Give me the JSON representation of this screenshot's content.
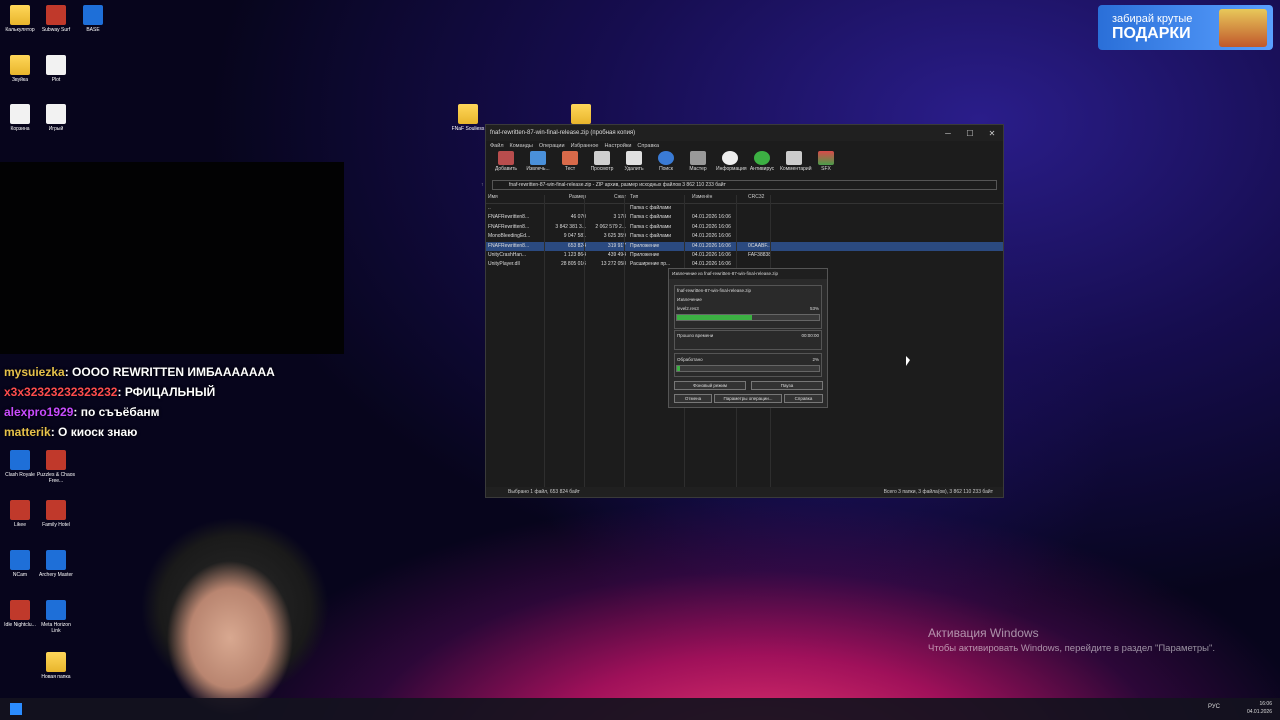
{
  "desktop_icons": [
    {
      "label": "Калькулятор",
      "icon": "folder-icon"
    },
    {
      "label": "Subway Surf",
      "icon": "subway-surf-icon"
    },
    {
      "label": "BASE",
      "icon": "base-app-icon"
    },
    {
      "label": "Звуйка",
      "icon": "folder-icon"
    },
    {
      "label": "Plot",
      "icon": "document-icon"
    },
    {
      "label": "Корзина",
      "icon": "recycle-bin-icon"
    },
    {
      "label": "Игрый",
      "icon": "document-icon"
    },
    {
      "label": "FNaF Souliess",
      "icon": "folder-icon"
    },
    {
      "label": "Clash Royale",
      "icon": "clash-royale-icon"
    },
    {
      "label": "Puzzles & Chaos Free...",
      "icon": "puzzles-icon"
    },
    {
      "label": "Likee",
      "icon": "likee-icon"
    },
    {
      "label": "Family Hotel",
      "icon": "family-hotel-icon"
    },
    {
      "label": "NCam",
      "icon": "ncam-icon"
    },
    {
      "label": "Archery Master",
      "icon": "archery-icon"
    },
    {
      "label": "Idle Nightclu...",
      "icon": "idle-icon"
    },
    {
      "label": "Meta Horizon Link",
      "icon": "meta-icon"
    },
    {
      "label": "Новая папка",
      "icon": "folder-icon"
    }
  ],
  "chat": [
    {
      "user": "mysuiezka",
      "msg": "OOOO REWRITTEN ИМБААААААА"
    },
    {
      "user": "x3x32323232323232",
      "msg": "РФИЦАЛЬНЫЙ"
    },
    {
      "user": "alexpro1929",
      "msg": "по съъёбанм"
    },
    {
      "user": "matterik",
      "msg": "О киоск знаю"
    }
  ],
  "promo": {
    "line1": "забирай крутые",
    "line2": "ПОДАРКИ"
  },
  "winrar": {
    "title": "fnaf-rewritten-87-win-final-release.zip (пробная копия)",
    "menu": [
      "Файл",
      "Команды",
      "Операции",
      "Избранное",
      "Настройки",
      "Справка"
    ],
    "toolbar": [
      "Добавить",
      "Извлечь...",
      "Тест",
      "Просмотр",
      "Удалить",
      "Поиск",
      "Мастер",
      "Информация",
      "Антивирус",
      "Комментарий",
      "SFX"
    ],
    "address": "fnaf-rewritten-87-win-final-release.zip - ZIP архив, размер исходных файлов 3 862 110 233 байт",
    "columns": [
      "Имя",
      "Размер",
      "Сжат",
      "Тип",
      "Изменён",
      "CRC32"
    ],
    "rows": [
      {
        "name": "..",
        "size": "",
        "packed": "",
        "type": "Папка с файлами",
        "modified": "",
        "crc": ""
      },
      {
        "name": "FNAFRewritten8...",
        "size": "46 070",
        "packed": "3 178",
        "type": "Папка с файлами",
        "modified": "04.01.2026 16:06",
        "crc": ""
      },
      {
        "name": "FNAFRewritten8...",
        "size": "3 842 381 3...",
        "packed": "2 062 579 2...",
        "type": "Папка с файлами",
        "modified": "04.01.2026 16:06",
        "crc": ""
      },
      {
        "name": "MonoBleedingEd...",
        "size": "9 047 581",
        "packed": "3 625 359",
        "type": "Папка с файлами",
        "modified": "04.01.2026 16:06",
        "crc": ""
      },
      {
        "name": "FNAFRewritten8...",
        "size": "653 824",
        "packed": "319 917",
        "type": "Приложение",
        "modified": "04.01.2026 16:06",
        "crc": "0CAABF..."
      },
      {
        "name": "UnityCrashHan...",
        "size": "1 123 864",
        "packed": "439 494",
        "type": "Приложение",
        "modified": "04.01.2026 16:06",
        "crc": "FAF38838"
      },
      {
        "name": "UnityPlayer.dll",
        "size": "28 805 016",
        "packed": "13 272 058",
        "type": "Расширение пр...",
        "modified": "04.01.2026 16:06",
        "crc": ""
      }
    ],
    "status_left": "Выбрано 1 файл, 653 824 байт",
    "status_right": "Всего 3 папки, 3 файла(ов), 3 862 110 233 байт"
  },
  "extract_dialog": {
    "title": "Извлечение из fnaf-rewritten-87-win-final-release.zip",
    "archive": "fnaf-rewritten-87-win-final-release.zip",
    "action": "Извлечение",
    "file": "level2.res3",
    "file_percent": "53%",
    "file_progress": 0.53,
    "elapsed_label": "Прошло времени",
    "elapsed": "00:00:00",
    "processed_label": "Обработано",
    "processed_percent": "2%",
    "processed_progress": 0.02,
    "buttons": [
      "Фоновый режим",
      "Пауза",
      "Отмена",
      "Параметры операции...",
      "Справка"
    ]
  },
  "activation": {
    "line1": "Активация Windows",
    "line2": "Чтобы активировать Windows, перейдите в раздел \"Параметры\"."
  },
  "taskbar": {
    "lang": "РУС",
    "time": "16:06",
    "date": "04.01.2026"
  }
}
